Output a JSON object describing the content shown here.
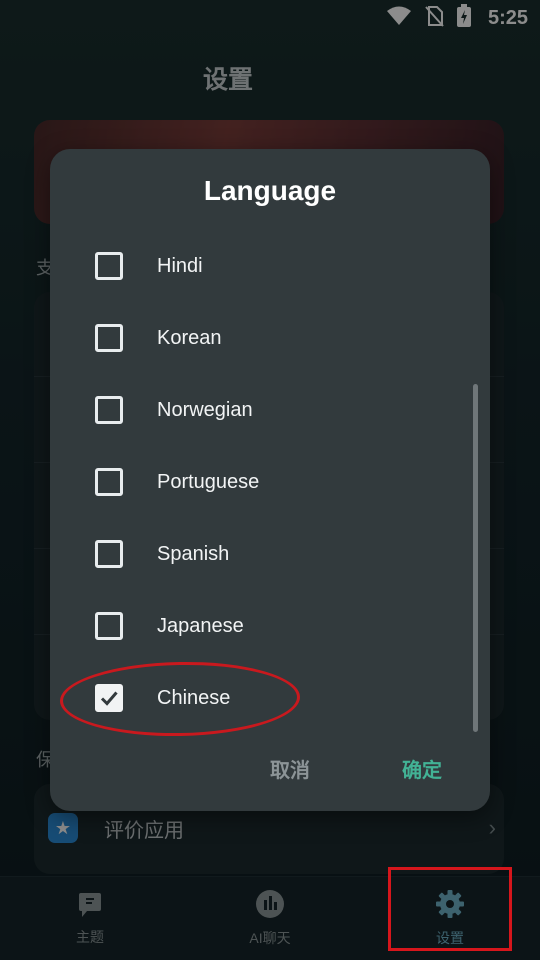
{
  "status_bar": {
    "time": "5:25"
  },
  "app": {
    "page_title": "设置",
    "banner_text": "",
    "section_support_label": "支",
    "section_privacy_label": "保",
    "rate_app_label": "评价应用"
  },
  "dialog": {
    "title": "Language",
    "options": [
      {
        "label": "Hindi",
        "checked": false
      },
      {
        "label": "Korean",
        "checked": false
      },
      {
        "label": "Norwegian",
        "checked": false
      },
      {
        "label": "Portuguese",
        "checked": false
      },
      {
        "label": "Spanish",
        "checked": false
      },
      {
        "label": "Japanese",
        "checked": false
      },
      {
        "label": "Chinese",
        "checked": true
      }
    ],
    "cancel_label": "取消",
    "ok_label": "确定"
  },
  "bottom_nav": {
    "items": [
      {
        "label": "主题",
        "icon": "theme-flag-icon",
        "active": false
      },
      {
        "label": "AI聊天",
        "icon": "ai-chat-icon",
        "active": false
      },
      {
        "label": "设置",
        "icon": "gear-icon",
        "active": true
      }
    ]
  },
  "colors": {
    "accent": "#42b295",
    "annotation": "#d6161c",
    "dialog_bg": "#323a3d"
  }
}
